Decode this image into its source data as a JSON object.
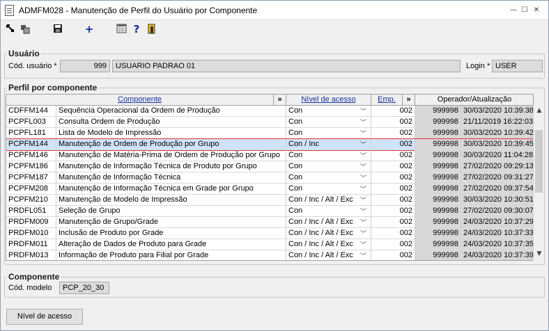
{
  "window": {
    "title": "ADMFM028 - Manutenção de Perfil do Usuário por Componente",
    "min": "—",
    "max": "☐",
    "close": "✕"
  },
  "toolbar": {
    "icons": [
      "arrow-icon",
      "copy-icon",
      "save-icon",
      "add-icon",
      "calendar-icon",
      "help-icon",
      "exit-icon"
    ],
    "add_glyph": "+",
    "help_glyph": "?"
  },
  "usuario": {
    "group": "Usuário",
    "cod_label": "Cód. usuário *",
    "cod_value": "999",
    "name_value": "USUARIO PADRAO 01",
    "login_label": "Login *",
    "login_value": "USER"
  },
  "perfil": {
    "group": "Perfil por componente",
    "headers": {
      "componente": "Componente",
      "nivel": "Nível de acesso",
      "emp": "Emp.",
      "operador": "Operador/Atualização",
      "expand": "»"
    },
    "rows": [
      {
        "code": "CDFFM144",
        "desc": "Sequência Operacional da Ordem de Produção",
        "nivel": "Con",
        "emp": "002",
        "op": "999998",
        "data": "30/03/2020 10:39:38"
      },
      {
        "code": "PCPFL003",
        "desc": "Consulta Ordem de Produção",
        "nivel": "Con",
        "emp": "002",
        "op": "999998",
        "data": "21/11/2019 16:22:03"
      },
      {
        "code": "PCPFL181",
        "desc": "Lista de Modelo de Impressão",
        "nivel": "Con",
        "emp": "002",
        "op": "999998",
        "data": "30/03/2020 10:39:42"
      },
      {
        "code": "PCPFM144",
        "desc": "Manutenção de Ordem de Produção por Grupo",
        "nivel": "Con / Inc",
        "emp": "002",
        "op": "999998",
        "data": "30/03/2020 10:39:45"
      },
      {
        "code": "PCPFM146",
        "desc": "Manutenção de Matéria-Prima de Ordem de Produção por Grupo",
        "nivel": "Con",
        "emp": "002",
        "op": "999998",
        "data": "30/03/2020 11:04:28"
      },
      {
        "code": "PCPFM186",
        "desc": "Manutenção de Informação Técnica de Produto por Grupo",
        "nivel": "Con",
        "emp": "002",
        "op": "999998",
        "data": "27/02/2020 09:29:13"
      },
      {
        "code": "PCPFM187",
        "desc": "Manutenção de Informação Técnica",
        "nivel": "Con",
        "emp": "002",
        "op": "999998",
        "data": "27/02/2020 09:31:27"
      },
      {
        "code": "PCPFM208",
        "desc": "Manutenção de Informação Técnica em Grade por Grupo",
        "nivel": "Con",
        "emp": "002",
        "op": "999998",
        "data": "27/02/2020 09:37:54"
      },
      {
        "code": "PCPFM210",
        "desc": "Manutenção de Modelo de Impressão",
        "nivel": "Con / Inc / Alt / Exc",
        "emp": "002",
        "op": "999998",
        "data": "30/03/2020 10:30:51"
      },
      {
        "code": "PRDFL051",
        "desc": "Seleção de Grupo",
        "nivel": "Con",
        "emp": "002",
        "op": "999998",
        "data": "27/02/2020 09:30:07"
      },
      {
        "code": "PRDFM009",
        "desc": "Manutenção de Grupo/Grade",
        "nivel": "Con / Inc / Alt / Exc",
        "emp": "002",
        "op": "999998",
        "data": "24/03/2020 10:37:29"
      },
      {
        "code": "PRDFM010",
        "desc": "Inclusão de Produto por Grade",
        "nivel": "Con / Inc / Alt / Exc",
        "emp": "002",
        "op": "999998",
        "data": "24/03/2020 10:37:33"
      },
      {
        "code": "PRDFM011",
        "desc": "Alteração de Dados de Produto para Grade",
        "nivel": "Con / Inc / Alt / Exc",
        "emp": "002",
        "op": "999998",
        "data": "24/03/2020 10:37:35"
      },
      {
        "code": "PRDFM013",
        "desc": "Informação de Produto para Filial por Grade",
        "nivel": "Con / Inc / Alt / Exc",
        "emp": "002",
        "op": "999998",
        "data": "24/03/2020 10:37:39"
      }
    ]
  },
  "componente": {
    "group": "Componente",
    "cod_label": "Cód. modelo",
    "cod_value": "PCP_20_30"
  },
  "button": {
    "nivel_label": "Nível de acesso"
  },
  "colors": {
    "selection_outline": "#e03030",
    "selection_fill": "#cfe4f8",
    "header_link": "#1030a0"
  }
}
